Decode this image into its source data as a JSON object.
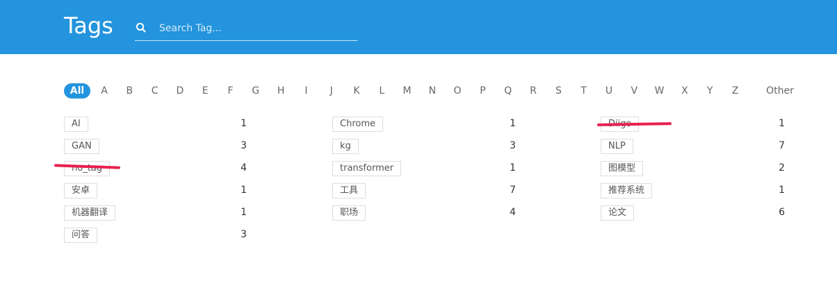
{
  "header": {
    "title": "Tags",
    "search_placeholder": "Search Tag...",
    "search_value": ""
  },
  "alphabet": [
    "All",
    "A",
    "B",
    "C",
    "D",
    "E",
    "F",
    "G",
    "H",
    "I",
    "J",
    "K",
    "L",
    "M",
    "N",
    "O",
    "P",
    "Q",
    "R",
    "S",
    "T",
    "U",
    "V",
    "W",
    "X",
    "Y",
    "Z",
    "Other"
  ],
  "active_letter": "All",
  "columns": [
    [
      {
        "tag": "AI",
        "count": "1"
      },
      {
        "tag": "GAN",
        "count": "3"
      },
      {
        "tag": "no_tag",
        "count": "4"
      },
      {
        "tag": "安卓",
        "count": "1"
      },
      {
        "tag": "机器翻译",
        "count": "1"
      },
      {
        "tag": "问答",
        "count": "3"
      }
    ],
    [
      {
        "tag": "Chrome",
        "count": "1"
      },
      {
        "tag": "kg",
        "count": "3"
      },
      {
        "tag": "transformer",
        "count": "1"
      },
      {
        "tag": "工具",
        "count": "7"
      },
      {
        "tag": "职场",
        "count": "4"
      }
    ],
    [
      {
        "tag": "Diigo",
        "count": "1"
      },
      {
        "tag": "NLP",
        "count": "7"
      },
      {
        "tag": "图模型",
        "count": "2"
      },
      {
        "tag": "推荐系统",
        "count": "1"
      },
      {
        "tag": "论文",
        "count": "6"
      }
    ]
  ],
  "colors": {
    "header_bg": "#2394dd",
    "annotation": "#e8204f"
  }
}
